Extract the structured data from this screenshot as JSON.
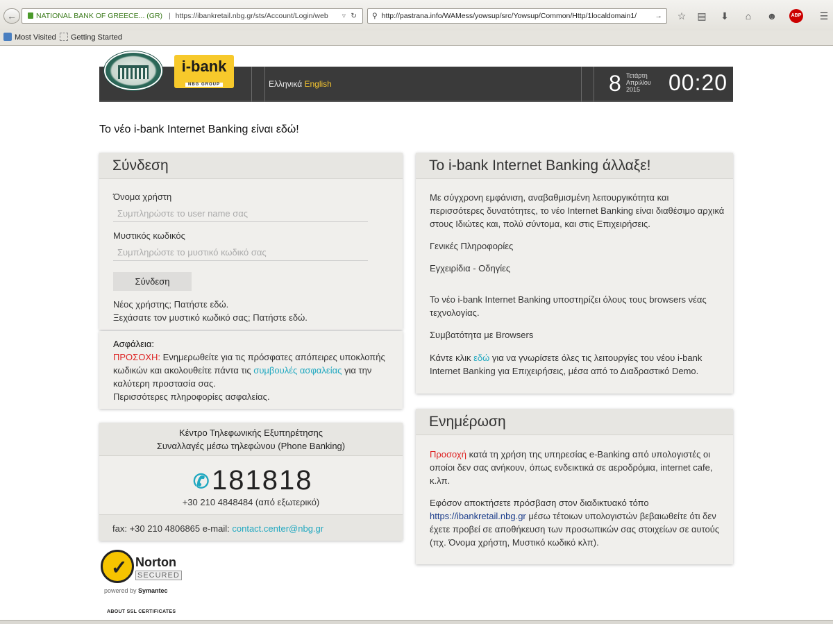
{
  "browser": {
    "url1_site": "NATIONAL BANK OF GREECE... (GR)",
    "url1": "https://ibankretail.nbg.gr/sts/Account/Login/web",
    "url2": "http://pastrana.info/WAMess/yowsup/src/Yowsup/Common/Http/1localdomain1/",
    "abp_label": "ABP",
    "bookmarks": [
      "Most Visited",
      "Getting Started"
    ]
  },
  "header": {
    "logo_text": "i-bank",
    "logo_sub": "NBG GROUP",
    "lang_greek": "Ελληνικά",
    "lang_english": "English",
    "date_day": "8",
    "date_weekday": "Τετάρτη",
    "date_month": "Απριλίου",
    "date_year": "2015",
    "clock": "00:20"
  },
  "welcome": "Το νέο i-bank Internet Banking είναι εδώ!",
  "login": {
    "title": "Σύνδεση",
    "username_label": "Όνομα χρήστη",
    "username_placeholder": "Συμπληρώστε το user name σας",
    "password_label": "Μυστικός κωδικός",
    "password_placeholder": "Συμπληρώστε το μυστικό κωδικό σας",
    "button": "Σύνδεση",
    "new_user": "Νέος χρήστης; Πατήστε εδώ.",
    "forgot": "Ξεχάσατε τον μυστικό κωδικό σας; Πατήστε εδώ."
  },
  "security": {
    "title": "Ασφάλεια:",
    "warning": "ΠΡΟΣΟΧΗ:",
    "text1": " Ενημερωθείτε για τις πρόσφατες απόπειρες υποκλοπής κωδικών και ακολουθείτε πάντα τις ",
    "link1": "συμβουλές ασφαλείας",
    "text2": " για την καλύτερη προστασία σας.",
    "more": "Περισσότερες πληροφορίες ασφαλείας."
  },
  "phone": {
    "line1": "Κέντρο Τηλεφωνικής Εξυπηρέτησης",
    "line2": "Συναλλαγές μέσω τηλεφώνου (Phone Banking)",
    "number": "181818",
    "abroad": "+30 210 4848484 (από εξωτερικό)",
    "fax_text": "fax: +30 210 4806865 e-mail: ",
    "email": "contact.center@nbg.gr"
  },
  "changed": {
    "title": "Το i-bank Internet Banking άλλαξε!",
    "p1": "Με σύγχρονη εμφάνιση, αναβαθμισμένη λειτουργικότητα και περισσότερες δυνατότητες, το νέο Internet Banking είναι διαθέσιμο αρχικά στους Ιδιώτες και, πολύ σύντομα, και στις Επιχειρήσεις.",
    "link_info": "Γενικές Πληροφορίες",
    "link_manuals": "Εγχειρίδια - Οδηγίες",
    "p2": "Το νέο i-bank Internet Banking υποστηρίζει όλους τους browsers νέας τεχνολογίας.",
    "link_browsers": "Συμβατότητα με Browsers",
    "p3_a": "Κάντε κλικ ",
    "p3_link": "εδώ",
    "p3_b": " για να γνωρίσετε όλες τις λειτουργίες του νέου i-bank Internet Banking για Επιχειρήσεις, μέσα από το Διαδραστικό Demo."
  },
  "news": {
    "title": "Ενημέρωση",
    "p1_red": "Προσοχή",
    "p1": " κατά τη χρήση της υπηρεσίας e-Banking από υπολογιστές οι οποίοι δεν σας ανήκουν, όπως ενδεικτικά σε αεροδρόμια, internet cafe, κ.λπ.",
    "p2_a": "Εφόσον αποκτήσετε πρόσβαση στον διαδικτυακό τόπο ",
    "p2_link": "https://ibankretail.nbg.gr",
    "p2_b": " μέσω τέτοιων υπολογιστών βεβαιωθείτε ότι δεν έχετε προβεί σε αποθήκευση των προσωπικών σας στοιχείων σε αυτούς (πχ. Όνομα χρήστη, Μυστικό κωδικό κλπ)."
  },
  "norton": {
    "brand": "Norton",
    "secured": "SECURED",
    "powered_prefix": "powered by ",
    "powered_brand": "Symantec",
    "ssl": "ABOUT SSL CERTIFICATES"
  }
}
